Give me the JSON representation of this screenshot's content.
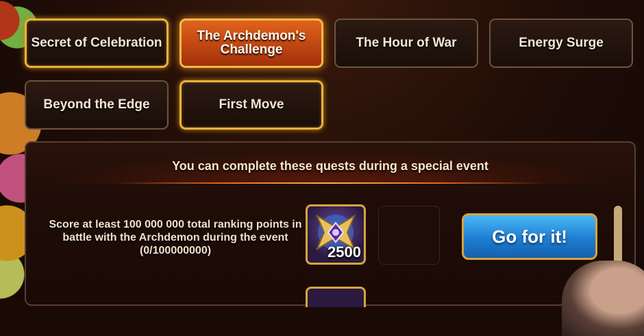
{
  "tabs": [
    {
      "label": "Secret of Celebration",
      "state": "gold"
    },
    {
      "label": "The Archdemon's Challenge",
      "state": "active"
    },
    {
      "label": "The Hour of War",
      "state": "dark"
    },
    {
      "label": "Energy Surge",
      "state": "dark"
    },
    {
      "label": "Beyond the Edge",
      "state": "dark"
    },
    {
      "label": "First Move",
      "state": "gold"
    }
  ],
  "panel": {
    "header": "You can complete these quests during a special event",
    "quest": {
      "description": "Score at least 100 000 000 total ranking points in battle with the Archdemon during the event (0/100000000)",
      "reward_icon": "archdemon-emblem-icon",
      "reward_count": "2500",
      "button_label": "Go for it!"
    }
  },
  "colors": {
    "active_tab": "#c84a12",
    "gold_border": "#e8b23a",
    "button_blue": "#2a8ee0"
  }
}
